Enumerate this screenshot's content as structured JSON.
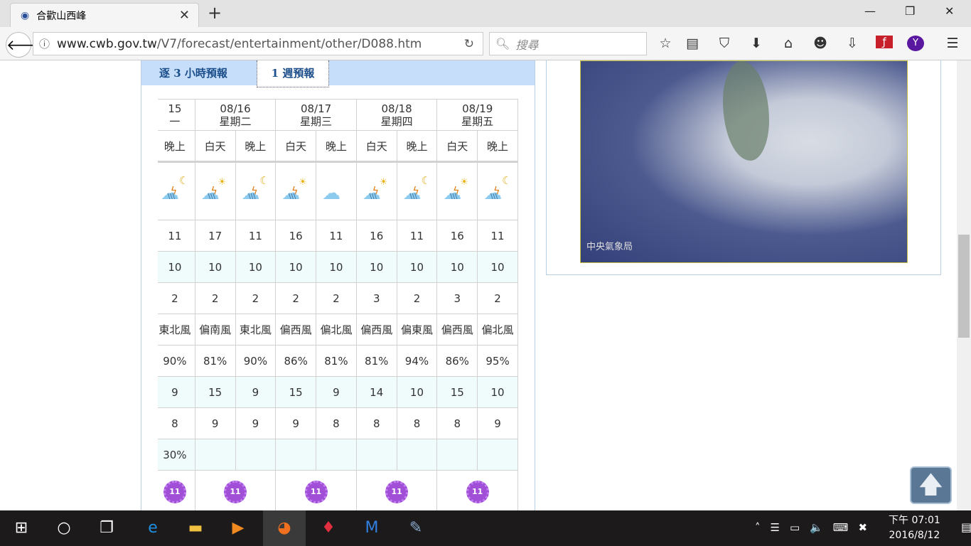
{
  "browser": {
    "tab_title": "合歡山西峰",
    "url_host": "www.cwb.gov.tw",
    "url_path": "/V7/forecast/entertainment/other/D088.htm",
    "search_placeholder": "搜尋"
  },
  "page": {
    "tabs": [
      {
        "label": "逐 3 小時預報"
      },
      {
        "label": "1 週預報"
      }
    ],
    "dates": [
      {
        "date": "15",
        "day": "一"
      },
      {
        "date": "08/16",
        "day": "星期二"
      },
      {
        "date": "08/17",
        "day": "星期三"
      },
      {
        "date": "08/18",
        "day": "星期四"
      },
      {
        "date": "08/19",
        "day": "星期五"
      }
    ],
    "periods": [
      "晚上",
      "白天",
      "晚上",
      "白天",
      "晚上",
      "白天",
      "晚上",
      "白天",
      "晚上"
    ],
    "weather_icons": [
      "cloud-thunder-moon",
      "cloud-thunder-sun",
      "cloud-thunder-moon",
      "cloud-thunder-sun",
      "cloud",
      "cloud-thunder-sun",
      "cloud-thunder-moon",
      "cloud-thunder-sun",
      "cloud-thunder-moon"
    ],
    "rows": [
      [
        "11",
        "17",
        "11",
        "16",
        "11",
        "16",
        "11",
        "16",
        "11"
      ],
      [
        "10",
        "10",
        "10",
        "10",
        "10",
        "10",
        "10",
        "10",
        "10"
      ],
      [
        "2",
        "2",
        "2",
        "2",
        "2",
        "3",
        "2",
        "3",
        "2"
      ],
      [
        "東北風",
        "偏南風",
        "東北風",
        "偏西風",
        "偏北風",
        "偏西風",
        "偏東風",
        "偏西風",
        "偏北風"
      ],
      [
        "90%",
        "81%",
        "90%",
        "86%",
        "81%",
        "81%",
        "94%",
        "86%",
        "95%"
      ],
      [
        "9",
        "15",
        "9",
        "15",
        "9",
        "14",
        "10",
        "15",
        "10"
      ],
      [
        "8",
        "9",
        "9",
        "9",
        "8",
        "8",
        "8",
        "8",
        "9"
      ],
      [
        "30%",
        "",
        "",
        "",
        "",
        "",
        "",
        "",
        ""
      ]
    ],
    "uv": [
      "11",
      "11",
      "11",
      "11",
      "11"
    ],
    "satellite_watermark": "中央氣象局"
  },
  "taskbar": {
    "time": "下午 07:01",
    "date": "2016/8/12"
  }
}
